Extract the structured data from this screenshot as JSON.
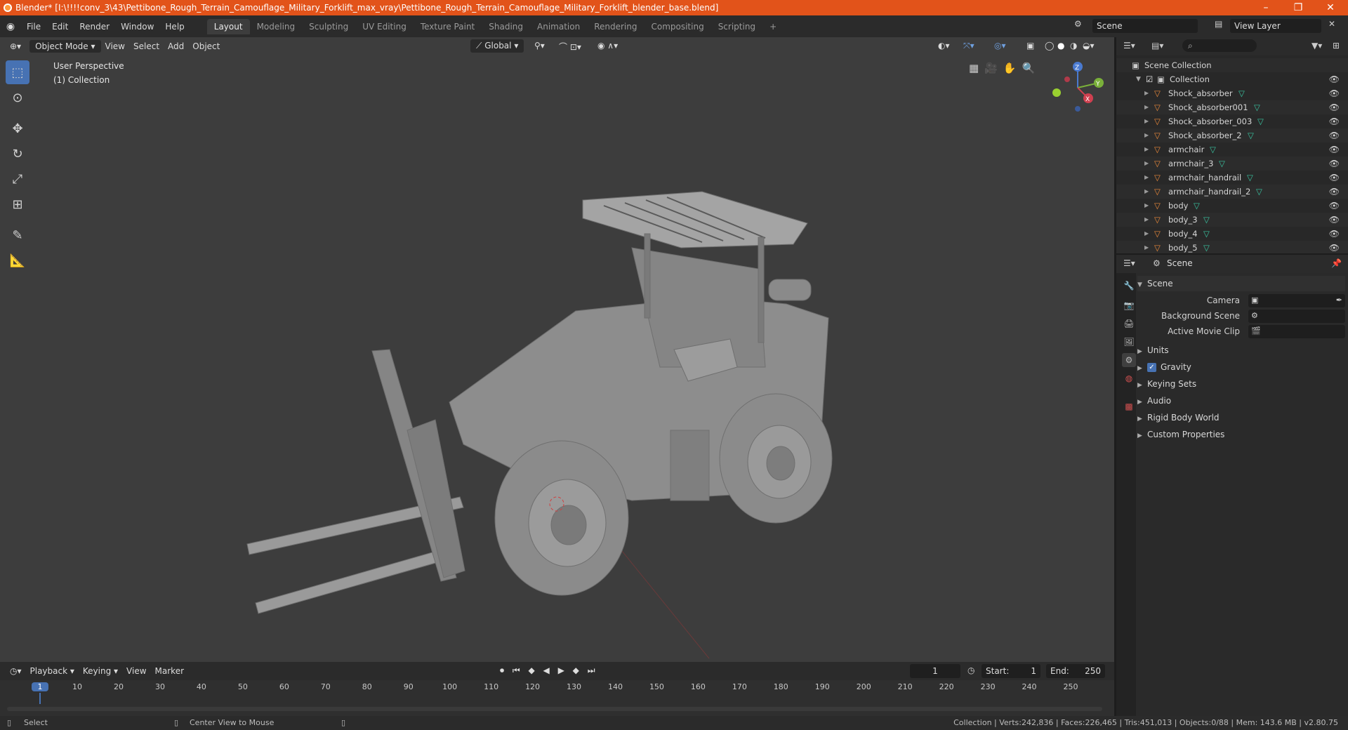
{
  "window": {
    "title": "Blender* [I:\\!!!!conv_3\\43\\Pettibone_Rough_Terrain_Camouflage_Military_Forklift_max_vray\\Pettibone_Rough_Terrain_Camouflage_Military_Forklift_blender_base.blend]",
    "minimize": "–",
    "maximize": "❐",
    "close": "✕"
  },
  "menus": [
    "File",
    "Edit",
    "Render",
    "Window",
    "Help"
  ],
  "workspaces": [
    "Layout",
    "Modeling",
    "Sculpting",
    "UV Editing",
    "Texture Paint",
    "Shading",
    "Animation",
    "Rendering",
    "Compositing",
    "Scripting"
  ],
  "workspace_add": "+",
  "scene_name": "Scene",
  "view_layer": "View Layer",
  "viewport": {
    "mode": "Object Mode",
    "menus": [
      "View",
      "Select",
      "Add",
      "Object"
    ],
    "transform_orientation": "Global",
    "info_line1": "User Perspective",
    "info_line2": "(1) Collection",
    "gizmo": {
      "x": "X",
      "y": "Y",
      "z": "Z"
    }
  },
  "outliner": {
    "root": "Scene Collection",
    "collection": "Collection",
    "items": [
      "Shock_absorber",
      "Shock_absorber001",
      "Shock_absorber_003",
      "Shock_absorber_2",
      "armchair",
      "armchair_3",
      "armchair_handrail",
      "armchair_handrail_2",
      "body",
      "body_3",
      "body_4",
      "body_5"
    ]
  },
  "properties": {
    "header": "Scene",
    "panel_title": "Scene",
    "rows": [
      {
        "label": "Camera"
      },
      {
        "label": "Background Scene"
      },
      {
        "label": "Active Movie Clip"
      }
    ],
    "panels": [
      "Units",
      "Gravity",
      "Keying Sets",
      "Audio",
      "Rigid Body World",
      "Custom Properties"
    ],
    "gravity_checked": true
  },
  "timeline": {
    "menus": [
      "Playback",
      "Keying",
      "View",
      "Marker"
    ],
    "current_frame": "1",
    "start_label": "Start:",
    "start": "1",
    "end_label": "End:",
    "end": "250",
    "ticks": [
      "1",
      "10",
      "20",
      "30",
      "40",
      "50",
      "60",
      "70",
      "80",
      "90",
      "100",
      "110",
      "120",
      "130",
      "140",
      "150",
      "160",
      "170",
      "180",
      "190",
      "200",
      "210",
      "220",
      "230",
      "240",
      "250"
    ]
  },
  "status": {
    "select": "Select",
    "center_view": "Center View to Mouse",
    "stats": "Collection | Verts:242,836 | Faces:226,465 | Tris:451,013 | Objects:0/88 | Mem: 143.6 MB | v2.80.75"
  },
  "colors": {
    "titlebar": "#e2531a",
    "accent": "#4772b3",
    "mesh_icon": "#e8883a",
    "data_icon": "#39c3a0"
  }
}
